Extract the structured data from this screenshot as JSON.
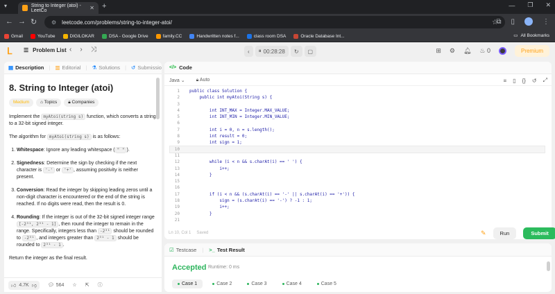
{
  "browser": {
    "tab_title": "String to Integer (atoi) - LeetCo",
    "url": "leetcode.com/problems/string-to-integer-atoi/",
    "bookmarks": [
      {
        "label": "Gmail",
        "color": "#ea4335"
      },
      {
        "label": "YouTube",
        "color": "#ff0000"
      },
      {
        "label": "DIGILOKAR",
        "color": "#f4b400"
      },
      {
        "label": "DSA - Google Drive",
        "color": "#34a853"
      },
      {
        "label": "family.CC",
        "color": "#ff9800"
      },
      {
        "label": "Handwritten notes f...",
        "color": "#4285f4"
      },
      {
        "label": "class room DSA",
        "color": "#1a73e8"
      },
      {
        "label": "Oracle Database Int...",
        "color": "#c74634"
      }
    ],
    "all_bookmarks": "All Bookmarks"
  },
  "nav": {
    "problem_list": "Problem List",
    "timer": "00:28:28",
    "fire_count": "0",
    "premium": "Premium"
  },
  "left": {
    "tabs": [
      "Description",
      "Editorial",
      "Solutions",
      "Submissions"
    ],
    "title": "8. String to Integer (atoi)",
    "difficulty": "Medium",
    "topics": "Topics",
    "companies": "Companies",
    "p1_a": "Implement the ",
    "p1_code": "myAtoi(string s)",
    "p1_b": " function, which converts a string to a 32-bit signed integer.",
    "p2_a": "The algorithm for ",
    "p2_code": "myAtoi(string s)",
    "p2_b": " is as follows:",
    "s1_t": "Whitespace",
    "s1_a": ": Ignore any leading whitespace (",
    "s1_code": "\" \"",
    "s1_b": ").",
    "s2_t": "Signedness",
    "s2_a": ": Determine the sign by checking if the next character is ",
    "s2_c1": "'-'",
    "s2_b": " or ",
    "s2_c2": "'+'",
    "s2_c": ", assuming positivity is neither present.",
    "s3_t": "Conversion",
    "s3_a": ": Read the integer by skipping leading zeros until a non-digit character is encountered or the end of the string is reached. If no digits were read, then the result is 0.",
    "s4_t": "Rounding",
    "s4_a": ": If the integer is out of the 32-bit signed integer range ",
    "s4_c1": "[-2³¹, 2³¹ - 1]",
    "s4_b": ", then round the integer to remain in the range. Specifically, integers less than ",
    "s4_c2": "-2³¹",
    "s4_c": " should be rounded to ",
    "s4_c3": "-2³¹",
    "s4_d": ", and integers greater than ",
    "s4_c4": "2³¹ - 1",
    "s4_e": " should be rounded to ",
    "s4_c5": "2³¹ - 1",
    "s4_f": ".",
    "final": "Return the integer as the final result.",
    "likes": "4.7K",
    "comments": "564"
  },
  "editor": {
    "header": "Code",
    "language": "Java",
    "mode": "Auto",
    "lines": [
      "public class Solution {",
      "    public int myAtoi(String s) {",
      "",
      "        int INT_MAX = Integer.MAX_VALUE;",
      "        int INT_MIN = Integer.MIN_VALUE;",
      "",
      "        int i = 0, n = s.length();",
      "        int result = 0;",
      "        int sign = 1;",
      "",
      "",
      "        while (i < n && s.charAt(i) == ' ') {",
      "            i++;",
      "        }",
      "",
      "",
      "        if (i < n && (s.charAt(i) == '-' || s.charAt(i) == '+')) {",
      "            sign = (s.charAt(i) == '-') ? -1 : 1;",
      "            i++;",
      "        }",
      ""
    ],
    "cursor": "Ln 10, Col 1",
    "saved": "Saved",
    "run": "Run",
    "submit": "Submit"
  },
  "result": {
    "tabs": [
      "Testcase",
      "Test Result"
    ],
    "status": "Accepted",
    "runtime": "Runtime: 0 ms",
    "cases": [
      "Case 1",
      "Case 2",
      "Case 3",
      "Case 4",
      "Case 5"
    ]
  }
}
